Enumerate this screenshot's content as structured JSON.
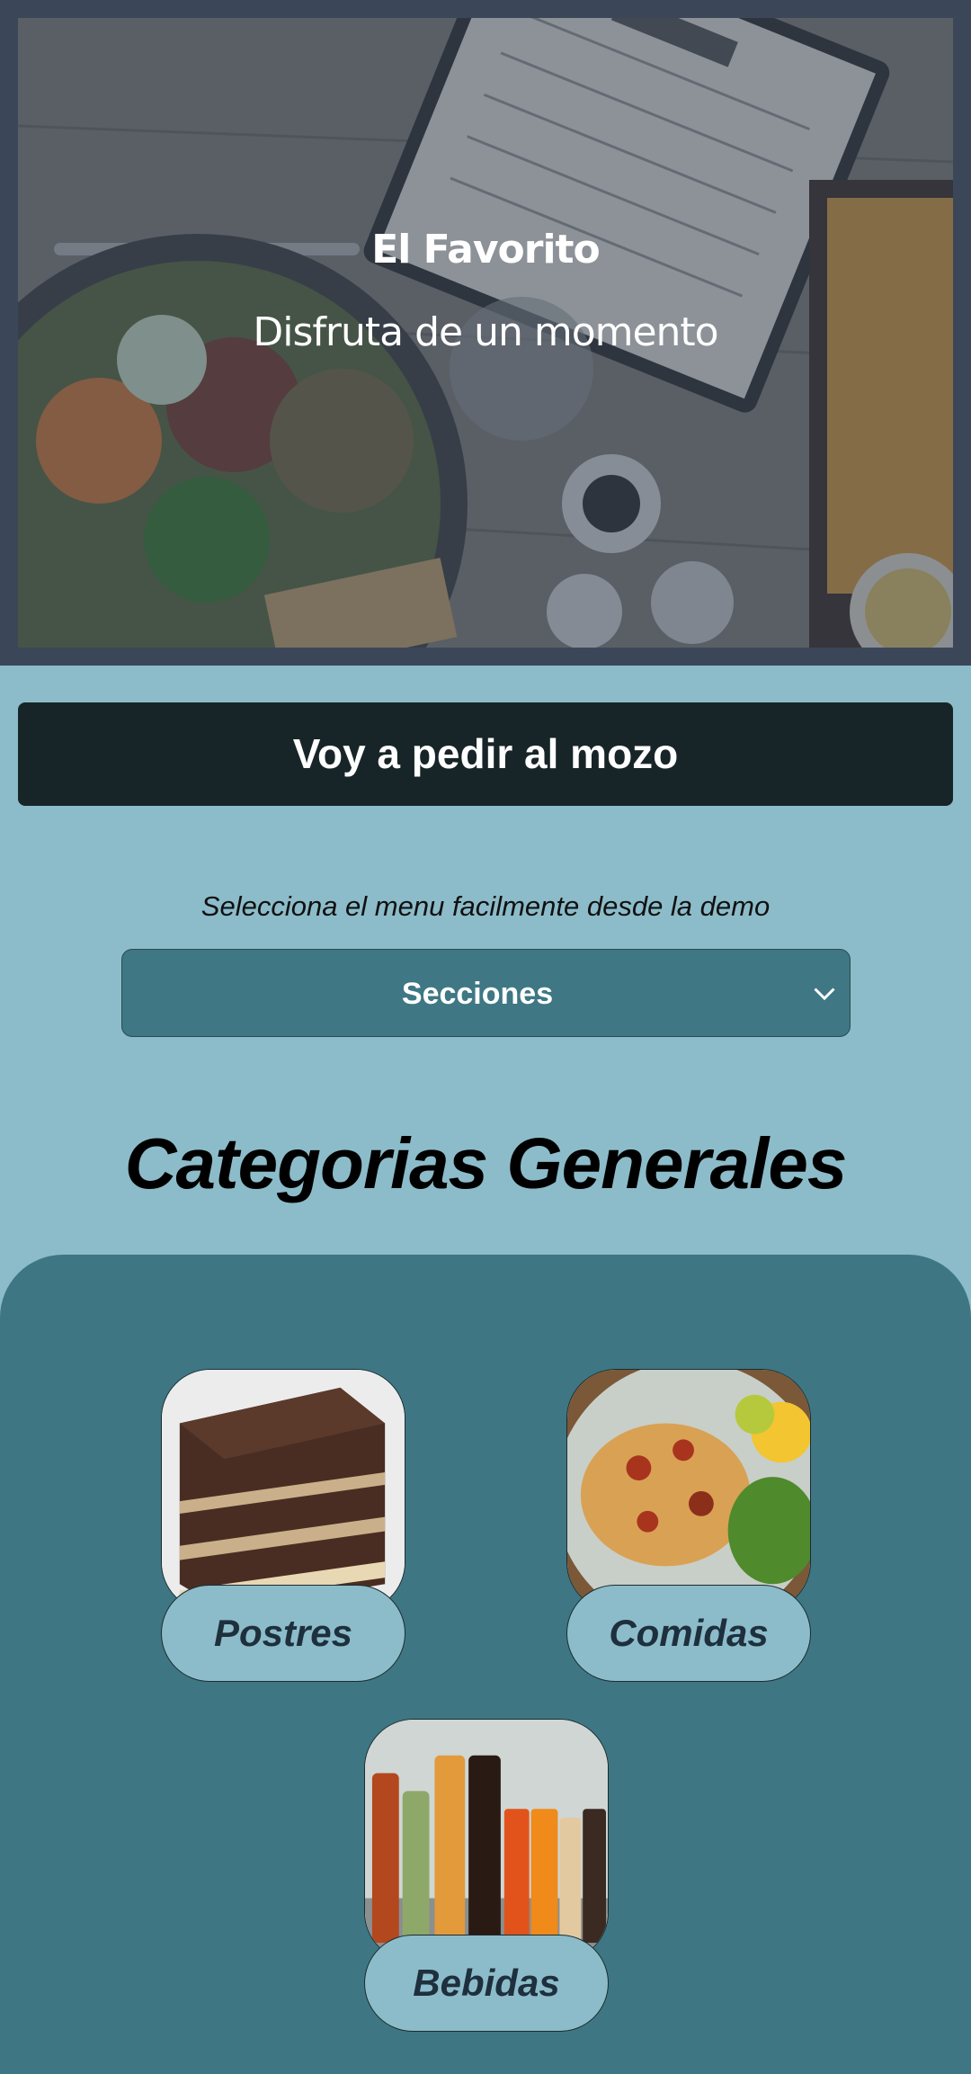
{
  "hero": {
    "title": "El Favorito",
    "subtitle": "Disfruta de un momento"
  },
  "mozo_button": {
    "label": "Voy a pedir al mozo"
  },
  "menu_select": {
    "instruction": "Selecciona el menu facilmente desde la demo",
    "selected": "Secciones"
  },
  "categories": {
    "heading": "Categorias Generales",
    "items": [
      {
        "label": "Postres",
        "image": "cake-photo"
      },
      {
        "label": "Comidas",
        "image": "grilled-fish-photo"
      },
      {
        "label": "Bebidas",
        "image": "bottles-photo"
      }
    ]
  },
  "colors": {
    "page_bg": "#8cbcc9",
    "hero_border": "#3b4759",
    "mozo_button_bg": "#182528",
    "select_bg": "#3f7784",
    "panel_bg": "#3e7783",
    "pill_text": "#1e2f3d"
  }
}
